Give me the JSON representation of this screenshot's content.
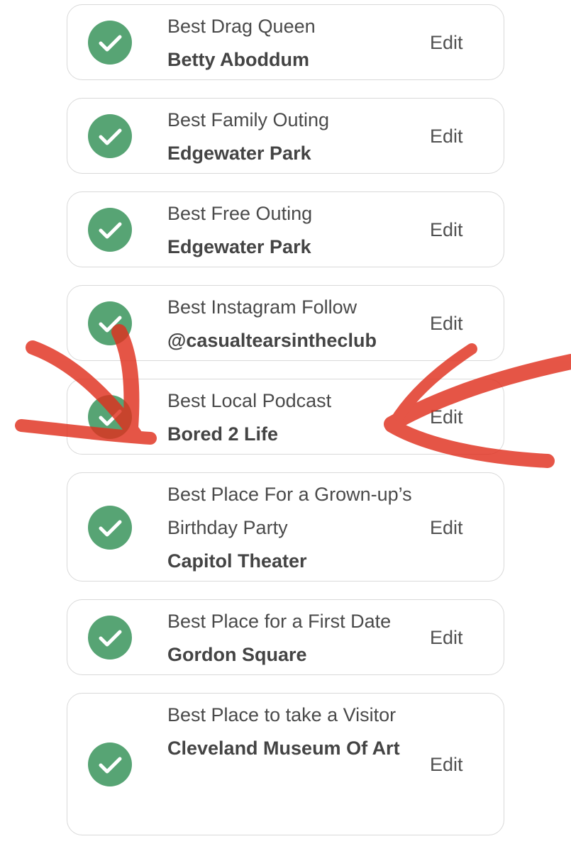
{
  "colors": {
    "check_green": "#57a474",
    "card_border": "#d9d9d9",
    "annotation_red": "#e0301e"
  },
  "annotation": "two red hand-drawn arrows pointing at the Best Local Podcast card",
  "ballot": {
    "items": [
      {
        "category": "Best Drag Queen",
        "value": "Betty Aboddum",
        "edit_label": "Edit",
        "icon": "check-icon"
      },
      {
        "category": "Best Family Outing",
        "value": "Edgewater Park",
        "edit_label": "Edit",
        "icon": "check-icon"
      },
      {
        "category": "Best Free Outing",
        "value": "Edgewater Park",
        "edit_label": "Edit",
        "icon": "check-icon"
      },
      {
        "category": "Best Instagram Follow",
        "value": "@casualtearsintheclub",
        "edit_label": "Edit",
        "icon": "check-icon"
      },
      {
        "category": "Best Local Podcast",
        "value": "Bored 2 Life",
        "edit_label": "Edit",
        "icon": "check-icon"
      },
      {
        "category": "Best Place For a Grown-up’s Birthday Party",
        "value": "Capitol Theater",
        "edit_label": "Edit",
        "icon": "check-icon"
      },
      {
        "category": "Best Place for a First Date",
        "value": "Gordon Square",
        "edit_label": "Edit",
        "icon": "check-icon"
      },
      {
        "category": "Best Place to take a Visitor",
        "value": "Cleveland Museum Of Art",
        "edit_label": "Edit",
        "icon": "check-icon"
      }
    ]
  }
}
